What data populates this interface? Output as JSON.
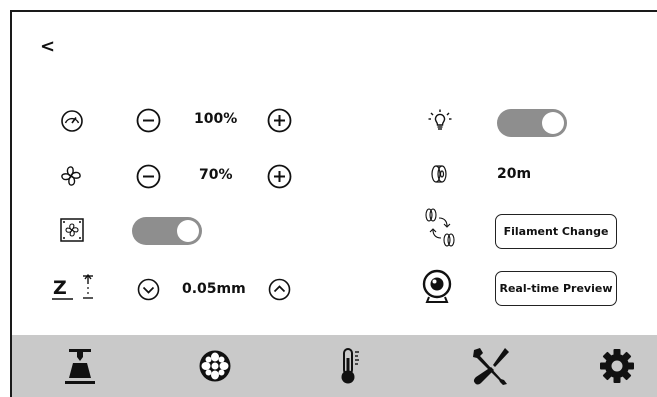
{
  "header": {
    "back_label": "<"
  },
  "left": {
    "speed": {
      "icon": "gauge-icon",
      "value": "100%"
    },
    "fan": {
      "icon": "fan-icon",
      "value": "70%"
    },
    "case_fan": {
      "icon": "case-fan-icon",
      "toggle_on": true
    },
    "z_offset": {
      "icon_text": "Z",
      "value": "0.05mm"
    }
  },
  "right": {
    "light": {
      "icon": "light-bulb-icon",
      "toggle_on": true
    },
    "filament": {
      "icon": "filament-spool-icon",
      "value": "20m"
    },
    "filament_change": {
      "icon": "filament-swap-icon",
      "button_label": "Filament Change"
    },
    "camera": {
      "icon": "webcam-icon",
      "button_label": "Real-time Preview"
    }
  },
  "navbar": {
    "items": [
      "print-icon",
      "fan-wheel-icon",
      "thermometer-icon",
      "tools-icon",
      "settings-gear-icon"
    ]
  },
  "colors": {
    "toggle_bg": "#8e8e8e",
    "navbar_bg": "#c9c9c9"
  }
}
